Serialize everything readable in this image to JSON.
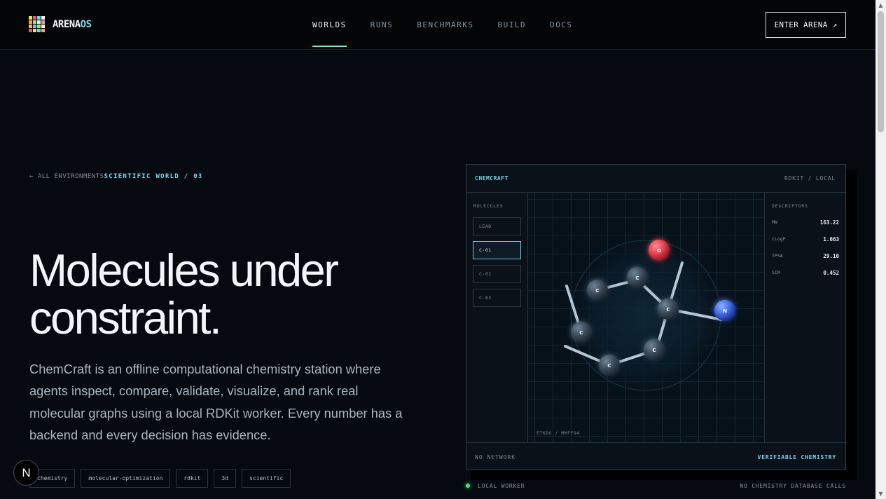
{
  "brand": {
    "name_main": "ARENA",
    "name_accent": "OS",
    "logo_colors": [
      "#e8e06a",
      "#e35a6c",
      "#76d2e6",
      "#f0f0f0",
      "#f4a261",
      "#9fe07a",
      "#e6e6e6",
      "#f58fb0",
      "#e8c15a",
      "#7fb5f0",
      "#9fe07a",
      "#f0f0f0",
      "#e35a6c",
      "#e8e06a",
      "#76d2e6",
      "#f4a261"
    ]
  },
  "nav": [
    {
      "label": "WORLDS",
      "active": true
    },
    {
      "label": "RUNS",
      "active": false
    },
    {
      "label": "BENCHMARKS",
      "active": false
    },
    {
      "label": "BUILD",
      "active": false
    },
    {
      "label": "DOCS",
      "active": false
    }
  ],
  "cta": {
    "label": "ENTER ARENA ↗"
  },
  "breadcrumb": {
    "back": "← ALL ENVIRONMENTS",
    "world": "SCIENTIFIC WORLD / 03"
  },
  "hero": {
    "title_line1": "Molecules under",
    "title_line2": "constraint.",
    "description": "ChemCraft is an offline computational chemistry station where agents inspect, compare, validate, visualize, and rank real molecular graphs using a local RDKit worker. Every number has a backend and every decision has evidence."
  },
  "tags": [
    "chemistry",
    "molecular-optimization",
    "rdkit",
    "3d",
    "scientific"
  ],
  "badge": {
    "letter": "N"
  },
  "panel": {
    "title": "CHEMCRAFT",
    "engine": "RDKIT / LOCAL",
    "molecules_label": "MOLECULES",
    "molecules": [
      {
        "label": "LEAD",
        "active": false
      },
      {
        "label": "C-01",
        "active": true
      },
      {
        "label": "C-02",
        "active": false
      },
      {
        "label": "C-03",
        "active": false
      }
    ],
    "viewport_caption": "ETKDG / MMFF94",
    "descriptors_label": "DESCRIPTORS",
    "descriptors": [
      {
        "key": "MW",
        "value": "163.22"
      },
      {
        "key": "cLogP",
        "value": "1.663"
      },
      {
        "key": "TPSA",
        "value": "29.10"
      },
      {
        "key": "SIM",
        "value": "0.452"
      }
    ],
    "footer_left": "NO NETWORK",
    "footer_right": "VERIFIABLE CHEMISTRY"
  },
  "status": {
    "left": "LOCAL WORKER",
    "right": "NO CHEMISTRY DATABASE CALLS"
  },
  "colors": {
    "accent": "#7cd4e8",
    "oxygen": "#e8404f",
    "nitrogen": "#3f6ce8",
    "carbon": "#3a4a59"
  }
}
